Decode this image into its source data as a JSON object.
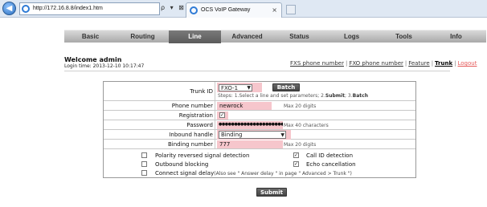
{
  "browser": {
    "url": "http://172.16.8.8/index1.htm",
    "tab_title": "OCS VoIP Gateway",
    "tab_close": "×",
    "back": "◀",
    "addr_tools": "ρ ▾ ⊠ ↻"
  },
  "nav": {
    "items": [
      "Basic",
      "Routing",
      "Line",
      "Advanced",
      "Status",
      "Logs",
      "Tools",
      "Info"
    ],
    "active": "Line"
  },
  "header": {
    "welcome": "Welcome admin",
    "login_time": "Login time: 2013-12-10 10:17:47"
  },
  "sub_links": {
    "fxs": "FXS phone number",
    "fxo": "FXO phone number",
    "feature": "Feature",
    "trunk": "Trunk",
    "logout": "Logout",
    "sep": "|"
  },
  "form": {
    "trunk_id_label": "Trunk ID",
    "trunk_id_value": "FXO-1",
    "batch_label": "Batch",
    "steps_prefix": "Steps: 1.Select a line and set parameters; 2.",
    "steps_submit": "Submit",
    "steps_mid": "; 3.",
    "steps_batch": "Batch",
    "phone_label": "Phone number",
    "phone_value": "newrock",
    "phone_hint": "Max 20 digits",
    "registration_label": "Registration",
    "registration_checked": "✓",
    "password_label": "Password",
    "password_value": "●●●●●●●●●●●●●●●●●●●●●●●",
    "password_hint": "Max 40 characters",
    "inbound_label": "Inbound handle",
    "inbound_value": "Binding",
    "binding_label": "Binding number",
    "binding_value": "777",
    "binding_hint": "Max 20 digits",
    "options": {
      "polarity": "Polarity reversed signal detection",
      "call_id": "Call ID detection",
      "outbound": "Outbound blocking",
      "echo": "Echo cancellation",
      "signal_delay": "Connect signal delay",
      "signal_delay_note": "(Also see \" Answer delay \" in page \" Advanced > Trunk \")",
      "checked_mark": "✓"
    },
    "submit_label": "Submit",
    "select_arrow": "▼"
  },
  "colors": {
    "highlight": "#f6c6cc",
    "nav_active": "#5a5a5a",
    "logout": "#e55a5a"
  }
}
